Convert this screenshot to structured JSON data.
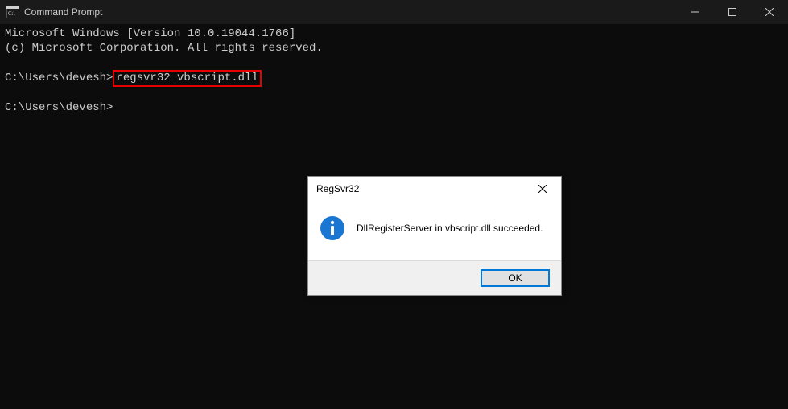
{
  "window": {
    "title": "Command Prompt"
  },
  "terminal": {
    "line1": "Microsoft Windows [Version 10.0.19044.1766]",
    "line2": "(c) Microsoft Corporation. All rights reserved.",
    "prompt1_prefix": "C:\\Users\\devesh>",
    "prompt1_cmd": "regsvr32 vbscript.dll",
    "prompt2": "C:\\Users\\devesh>"
  },
  "dialog": {
    "title": "RegSvr32",
    "message": "DllRegisterServer in vbscript.dll succeeded.",
    "ok_label": "OK"
  }
}
